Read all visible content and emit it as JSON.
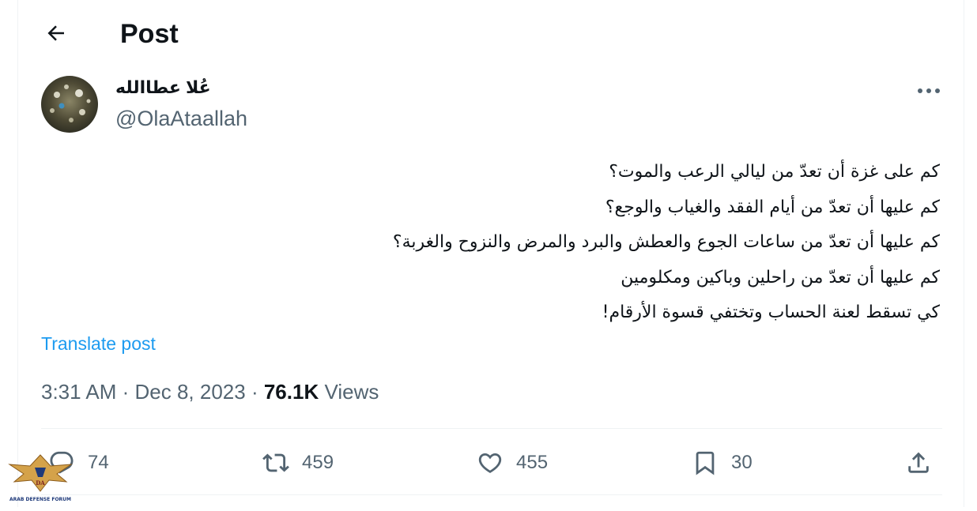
{
  "header": {
    "title": "Post"
  },
  "author": {
    "name": "عُلا عطاالله",
    "handle": "@OlaAtaallah"
  },
  "post": {
    "lines": [
      "كم على غزة أن تعدّ من ليالي الرعب والموت؟",
      "كم عليها أن تعدّ من أيام الفقد والغياب والوجع؟",
      "كم عليها أن تعدّ من ساعات الجوع والعطش والبرد والمرض والنزوح والغربة؟",
      "كم عليها أن تعدّ من راحلين وباكين ومكلومين",
      "كي تسقط لعنة الحساب وتختفي قسوة الأرقام!"
    ],
    "translate_label": "Translate post"
  },
  "meta": {
    "time": "3:31 AM",
    "sep1": " · ",
    "date": "Dec 8, 2023",
    "sep2": " · ",
    "views_count": "76.1K",
    "views_label": " Views"
  },
  "actions": {
    "replies": "74",
    "reposts": "459",
    "likes": "455",
    "bookmarks": "30"
  },
  "icons": {
    "back": "arrow-left-icon",
    "more": "more-dots-icon",
    "reply": "reply-icon",
    "repost": "repost-icon",
    "like": "heart-icon",
    "bookmark": "bookmark-icon",
    "share": "share-icon"
  },
  "watermark": {
    "text": "ARAB DEFENSE FORUM"
  },
  "colors": {
    "accent": "#1d9bf0",
    "muted": "#536471",
    "text": "#0f1419"
  }
}
